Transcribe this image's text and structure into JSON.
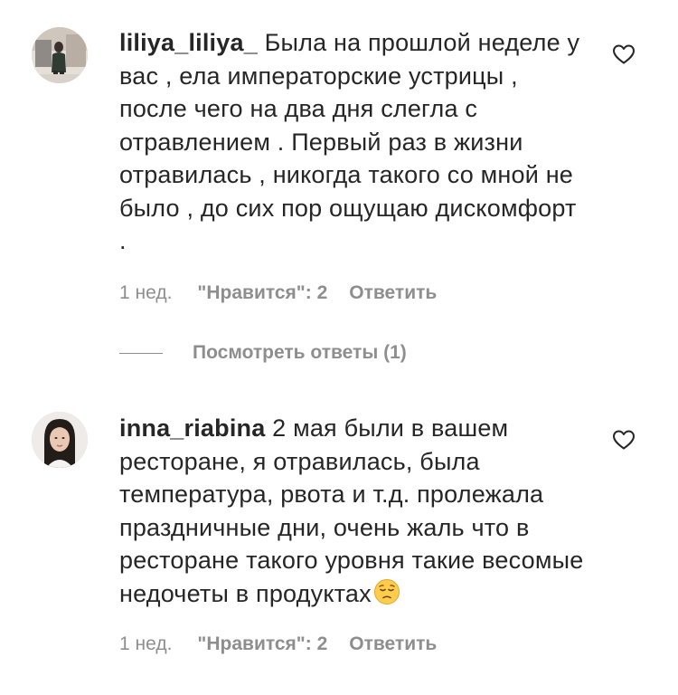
{
  "comments": [
    {
      "username": "liliya_liliya_",
      "text": " Была на прошлой неделе у вас , ела императорские устрицы , после чего на два дня слегла с отравлением . Первый раз в жизни отравилась , никогда такого со мной не было , до сих пор ощущаю дискомфорт .",
      "time": "1 нед.",
      "likes": "\"Нравится\": 2",
      "reply_label": "Ответить",
      "view_replies_label": "Посмотреть ответы (1)"
    },
    {
      "username": "inna_riabina",
      "text": " 2 мая были в вашем ресторане, я отравилась, была температура, рвота и т.д. пролежала праздничные дни, очень жаль что в ресторане такого уровня такие весомые недочеты в продуктах",
      "emoji": "pensive-face-emoji",
      "time": "1 нед.",
      "likes": "\"Нравится\": 2",
      "reply_label": "Ответить"
    }
  ],
  "colors": {
    "text": "#262626",
    "secondary": "#8e8e8e",
    "background": "#ffffff"
  },
  "icons": {
    "like": "heart-outline-icon"
  }
}
